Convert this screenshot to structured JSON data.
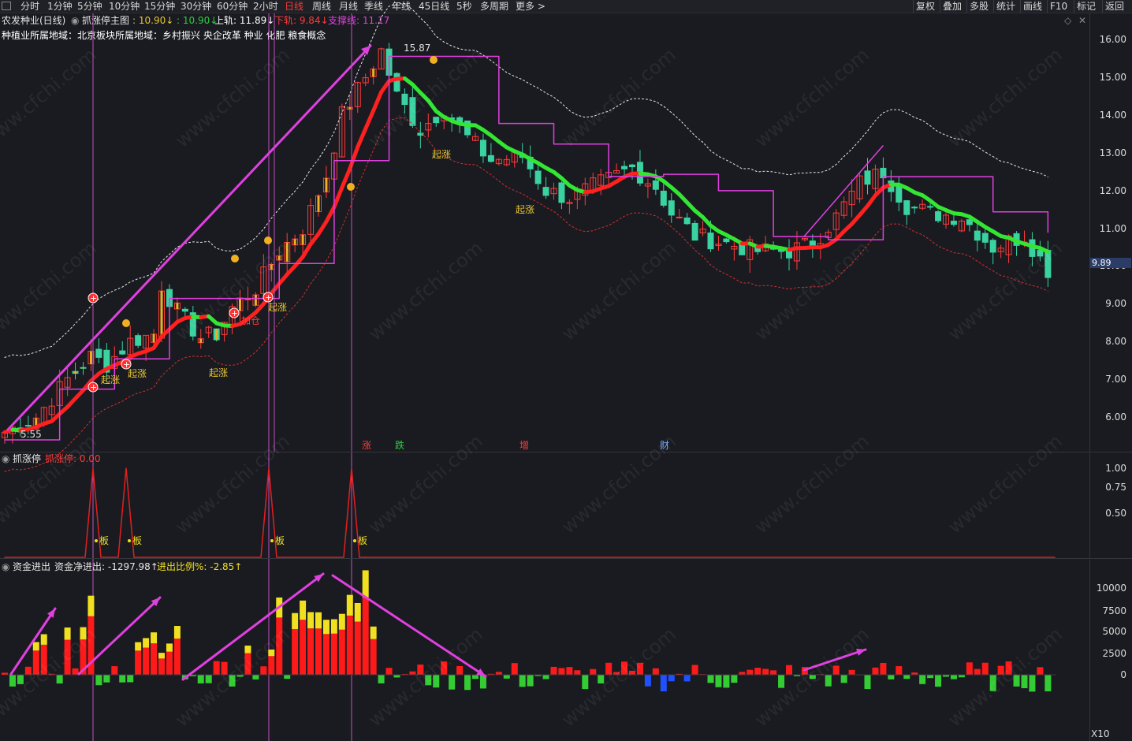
{
  "toolbar": {
    "periods": [
      "分时",
      "1分钟",
      "5分钟",
      "10分钟",
      "15分钟",
      "30分钟",
      "60分钟",
      "2小时",
      "日线",
      "周线",
      "月线",
      "季线",
      "年线",
      "45日线",
      "5秒",
      "多周期",
      "更多 >"
    ],
    "active_index": 8,
    "right_buttons": [
      "复权",
      "叠加",
      "多股",
      "统计",
      "画线",
      "F10",
      "标记",
      "返回"
    ]
  },
  "main_panel": {
    "stock": "农发种业(日线)",
    "indicator_name": "抓涨停主图",
    "values": [
      {
        "text": ": 10.90↓",
        "color": "#e8c530"
      },
      {
        "text": ": 10.90↓",
        "color": "#2ecc40"
      },
      {
        "text": "上轨: 11.89↓",
        "color": "#ffffff"
      },
      {
        "text": "下轨: 9.84↓",
        "color": "#ff3b3b"
      },
      {
        "text": "支撑线: 11.17",
        "color": "#e040e0"
      }
    ],
    "info_line": "种植业所属地域：北京板块所属地域：乡村振兴 央企改革 种业 化肥 粮食概念",
    "high_label": "15.87",
    "low_label": "5.55",
    "current_price": "9.89",
    "y_ticks": [
      "16.00",
      "15.00",
      "14.00",
      "13.00",
      "12.00",
      "11.00",
      "10.00",
      "9.00",
      "8.00",
      "7.00",
      "6.00"
    ],
    "signals": [
      {
        "text": "起涨",
        "color": "#e8c530"
      },
      {
        "text": "起涨",
        "color": "#e8c530"
      },
      {
        "text": "起涨",
        "color": "#e8c530"
      },
      {
        "text": "加仓",
        "color": "#ff3b3b"
      },
      {
        "text": "起涨",
        "color": "#e8c530"
      },
      {
        "text": "起涨",
        "color": "#e8c530"
      },
      {
        "text": "起涨",
        "color": "#e8c530"
      }
    ],
    "markers": [
      {
        "text": "涨",
        "color": "#ff3b3b"
      },
      {
        "text": "跌",
        "color": "#2ecc40"
      },
      {
        "text": "增",
        "color": "#ff3b3b"
      },
      {
        "text": "财",
        "color": "#6fa8ff"
      }
    ],
    "watermark": "www.cfchi.com"
  },
  "zt_panel": {
    "title": "抓涨停",
    "value": "抓涨停: 0.00",
    "board_label": "板",
    "y_ticks": [
      "1.00",
      "0.75",
      "0.50"
    ]
  },
  "fund_panel": {
    "title": "资金进出",
    "net": "资金净进出: -1297.98↑",
    "ratio": "进出比例%: -2.85↑",
    "y_ticks": [
      "10000",
      "7500",
      "5000",
      "2500",
      "0"
    ],
    "multiplier": "X10"
  },
  "colors": {
    "bg": "#1a1b20",
    "up": "#ff3b3b",
    "down": "#3ad2a0",
    "magenta": "#e040e0",
    "yellow": "#f0e020",
    "green": "#33e633"
  }
}
